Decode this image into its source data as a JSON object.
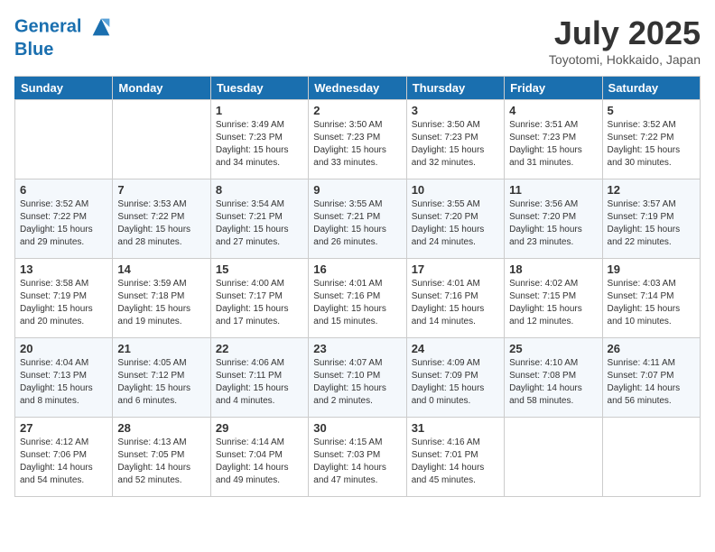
{
  "header": {
    "logo_line1": "General",
    "logo_line2": "Blue",
    "month": "July 2025",
    "location": "Toyotomi, Hokkaido, Japan"
  },
  "weekdays": [
    "Sunday",
    "Monday",
    "Tuesday",
    "Wednesday",
    "Thursday",
    "Friday",
    "Saturday"
  ],
  "weeks": [
    [
      {
        "day": "",
        "sunrise": "",
        "sunset": "",
        "daylight": ""
      },
      {
        "day": "",
        "sunrise": "",
        "sunset": "",
        "daylight": ""
      },
      {
        "day": "1",
        "sunrise": "Sunrise: 3:49 AM",
        "sunset": "Sunset: 7:23 PM",
        "daylight": "Daylight: 15 hours and 34 minutes."
      },
      {
        "day": "2",
        "sunrise": "Sunrise: 3:50 AM",
        "sunset": "Sunset: 7:23 PM",
        "daylight": "Daylight: 15 hours and 33 minutes."
      },
      {
        "day": "3",
        "sunrise": "Sunrise: 3:50 AM",
        "sunset": "Sunset: 7:23 PM",
        "daylight": "Daylight: 15 hours and 32 minutes."
      },
      {
        "day": "4",
        "sunrise": "Sunrise: 3:51 AM",
        "sunset": "Sunset: 7:23 PM",
        "daylight": "Daylight: 15 hours and 31 minutes."
      },
      {
        "day": "5",
        "sunrise": "Sunrise: 3:52 AM",
        "sunset": "Sunset: 7:22 PM",
        "daylight": "Daylight: 15 hours and 30 minutes."
      }
    ],
    [
      {
        "day": "6",
        "sunrise": "Sunrise: 3:52 AM",
        "sunset": "Sunset: 7:22 PM",
        "daylight": "Daylight: 15 hours and 29 minutes."
      },
      {
        "day": "7",
        "sunrise": "Sunrise: 3:53 AM",
        "sunset": "Sunset: 7:22 PM",
        "daylight": "Daylight: 15 hours and 28 minutes."
      },
      {
        "day": "8",
        "sunrise": "Sunrise: 3:54 AM",
        "sunset": "Sunset: 7:21 PM",
        "daylight": "Daylight: 15 hours and 27 minutes."
      },
      {
        "day": "9",
        "sunrise": "Sunrise: 3:55 AM",
        "sunset": "Sunset: 7:21 PM",
        "daylight": "Daylight: 15 hours and 26 minutes."
      },
      {
        "day": "10",
        "sunrise": "Sunrise: 3:55 AM",
        "sunset": "Sunset: 7:20 PM",
        "daylight": "Daylight: 15 hours and 24 minutes."
      },
      {
        "day": "11",
        "sunrise": "Sunrise: 3:56 AM",
        "sunset": "Sunset: 7:20 PM",
        "daylight": "Daylight: 15 hours and 23 minutes."
      },
      {
        "day": "12",
        "sunrise": "Sunrise: 3:57 AM",
        "sunset": "Sunset: 7:19 PM",
        "daylight": "Daylight: 15 hours and 22 minutes."
      }
    ],
    [
      {
        "day": "13",
        "sunrise": "Sunrise: 3:58 AM",
        "sunset": "Sunset: 7:19 PM",
        "daylight": "Daylight: 15 hours and 20 minutes."
      },
      {
        "day": "14",
        "sunrise": "Sunrise: 3:59 AM",
        "sunset": "Sunset: 7:18 PM",
        "daylight": "Daylight: 15 hours and 19 minutes."
      },
      {
        "day": "15",
        "sunrise": "Sunrise: 4:00 AM",
        "sunset": "Sunset: 7:17 PM",
        "daylight": "Daylight: 15 hours and 17 minutes."
      },
      {
        "day": "16",
        "sunrise": "Sunrise: 4:01 AM",
        "sunset": "Sunset: 7:16 PM",
        "daylight": "Daylight: 15 hours and 15 minutes."
      },
      {
        "day": "17",
        "sunrise": "Sunrise: 4:01 AM",
        "sunset": "Sunset: 7:16 PM",
        "daylight": "Daylight: 15 hours and 14 minutes."
      },
      {
        "day": "18",
        "sunrise": "Sunrise: 4:02 AM",
        "sunset": "Sunset: 7:15 PM",
        "daylight": "Daylight: 15 hours and 12 minutes."
      },
      {
        "day": "19",
        "sunrise": "Sunrise: 4:03 AM",
        "sunset": "Sunset: 7:14 PM",
        "daylight": "Daylight: 15 hours and 10 minutes."
      }
    ],
    [
      {
        "day": "20",
        "sunrise": "Sunrise: 4:04 AM",
        "sunset": "Sunset: 7:13 PM",
        "daylight": "Daylight: 15 hours and 8 minutes."
      },
      {
        "day": "21",
        "sunrise": "Sunrise: 4:05 AM",
        "sunset": "Sunset: 7:12 PM",
        "daylight": "Daylight: 15 hours and 6 minutes."
      },
      {
        "day": "22",
        "sunrise": "Sunrise: 4:06 AM",
        "sunset": "Sunset: 7:11 PM",
        "daylight": "Daylight: 15 hours and 4 minutes."
      },
      {
        "day": "23",
        "sunrise": "Sunrise: 4:07 AM",
        "sunset": "Sunset: 7:10 PM",
        "daylight": "Daylight: 15 hours and 2 minutes."
      },
      {
        "day": "24",
        "sunrise": "Sunrise: 4:09 AM",
        "sunset": "Sunset: 7:09 PM",
        "daylight": "Daylight: 15 hours and 0 minutes."
      },
      {
        "day": "25",
        "sunrise": "Sunrise: 4:10 AM",
        "sunset": "Sunset: 7:08 PM",
        "daylight": "Daylight: 14 hours and 58 minutes."
      },
      {
        "day": "26",
        "sunrise": "Sunrise: 4:11 AM",
        "sunset": "Sunset: 7:07 PM",
        "daylight": "Daylight: 14 hours and 56 minutes."
      }
    ],
    [
      {
        "day": "27",
        "sunrise": "Sunrise: 4:12 AM",
        "sunset": "Sunset: 7:06 PM",
        "daylight": "Daylight: 14 hours and 54 minutes."
      },
      {
        "day": "28",
        "sunrise": "Sunrise: 4:13 AM",
        "sunset": "Sunset: 7:05 PM",
        "daylight": "Daylight: 14 hours and 52 minutes."
      },
      {
        "day": "29",
        "sunrise": "Sunrise: 4:14 AM",
        "sunset": "Sunset: 7:04 PM",
        "daylight": "Daylight: 14 hours and 49 minutes."
      },
      {
        "day": "30",
        "sunrise": "Sunrise: 4:15 AM",
        "sunset": "Sunset: 7:03 PM",
        "daylight": "Daylight: 14 hours and 47 minutes."
      },
      {
        "day": "31",
        "sunrise": "Sunrise: 4:16 AM",
        "sunset": "Sunset: 7:01 PM",
        "daylight": "Daylight: 14 hours and 45 minutes."
      },
      {
        "day": "",
        "sunrise": "",
        "sunset": "",
        "daylight": ""
      },
      {
        "day": "",
        "sunrise": "",
        "sunset": "",
        "daylight": ""
      }
    ]
  ]
}
